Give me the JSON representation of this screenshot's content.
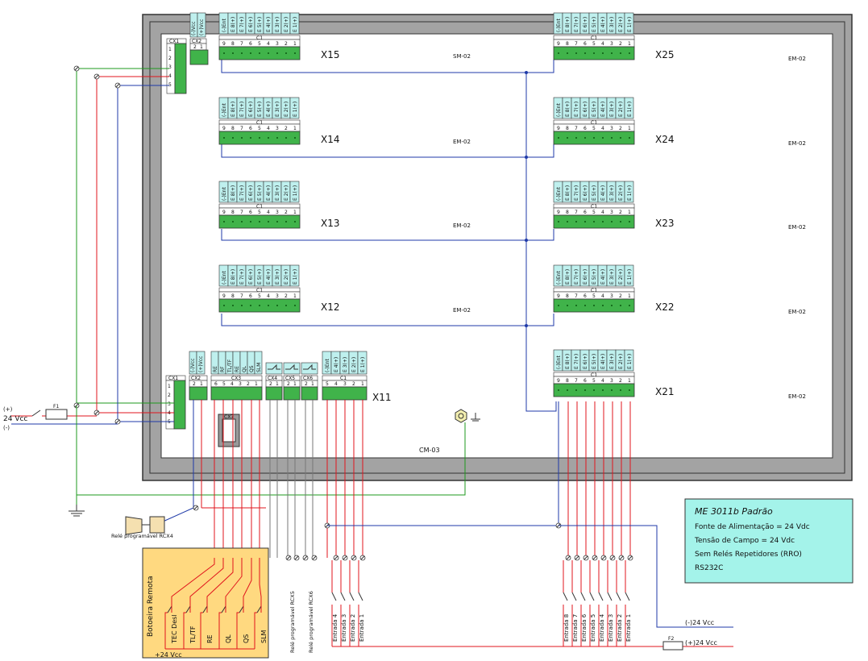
{
  "colors": {
    "frame": "#a3a3a3",
    "panel": "#ffffff",
    "terminal": "#40b34a",
    "label_box": "#bff0ee",
    "note_box": "#a4f3ea",
    "remote_box": "#ffd980",
    "red": "#e0141c",
    "blue": "#1f3aa8",
    "green": "#1c9a1c",
    "gray": "#555555"
  },
  "panel": {
    "title": "CM-03"
  },
  "modules": [
    {
      "id": "X15",
      "tag": "SM-02"
    },
    {
      "id": "X14",
      "tag": "EM-02"
    },
    {
      "id": "X13",
      "tag": "EM-02"
    },
    {
      "id": "X12",
      "tag": "EM-02"
    },
    {
      "id": "X25",
      "tag": "EM-02"
    },
    {
      "id": "X24",
      "tag": "EM-02"
    },
    {
      "id": "X23",
      "tag": "EM-02"
    },
    {
      "id": "X22",
      "tag": "EM-02"
    },
    {
      "id": "X21",
      "tag": "EM-02"
    }
  ],
  "module_conn": {
    "header": "C1",
    "pins": [
      "9",
      "8",
      "7",
      "6",
      "5",
      "4",
      "3",
      "2",
      "1"
    ],
    "labels": [
      "(-)Ent",
      "E 8(+)",
      "E 7(+)",
      "E 6(+)",
      "E 5(+)",
      "E 4(+)",
      "E 3(+)",
      "E 2(+)",
      "E 1(+)"
    ]
  },
  "x11": {
    "id": "X11",
    "cx1": {
      "header": "CX1",
      "pins": [
        "1",
        "2",
        "3",
        "4",
        "5"
      ]
    },
    "cx2": {
      "header": "CX2",
      "pins": [
        "2",
        "1"
      ],
      "labels": [
        "(-)Vcc",
        "(+)Vcc"
      ]
    },
    "cx3": {
      "header": "CX3",
      "pins": [
        "6",
        "5",
        "4",
        "3",
        "2",
        "1"
      ],
      "labels": [
        "RE",
        "RF",
        "TL/TF",
        "RE",
        "QL",
        "QS",
        "SLM"
      ]
    },
    "cx4": {
      "header": "CX4",
      "pins": [
        "2",
        "1"
      ]
    },
    "cx5": {
      "header": "CX5",
      "pins": [
        "2",
        "1"
      ]
    },
    "cx6": {
      "header": "CX6",
      "pins": [
        "2",
        "1"
      ]
    },
    "c1": {
      "header": "C1",
      "pins": [
        "5",
        "4",
        "3",
        "2",
        "1"
      ],
      "labels": [
        "(-)Ent",
        "E 4(+)",
        "E 3(+)",
        "E 2(+)",
        "E 1(+)"
      ]
    },
    "cx7": "CX7"
  },
  "top_power": {
    "cx1": "CX1",
    "cx2": "CX2",
    "cx2_pins": [
      "2",
      "1"
    ],
    "cx1_pins": [
      "1",
      "2",
      "3",
      "4",
      "5"
    ],
    "labels": [
      "(-)Vcc",
      "(+)Vcc"
    ]
  },
  "supply": {
    "plus": "(+)",
    "volt": "24  Vcc",
    "minus": "(-)",
    "fuse": "F1"
  },
  "relay4": "Relé programável RCX4",
  "remote": {
    "title": "Botoeira Remota",
    "buttons": [
      "TEC Desl",
      "TL/TF",
      "RE",
      "QL",
      "QS",
      "SLM"
    ],
    "supply": "+24  Vcc"
  },
  "relays": [
    "Relé programável RCX5",
    "Relé programável RCX6"
  ],
  "inputs_x11": [
    "Entrada 4",
    "Entrada 3",
    "Entrada 2",
    "Entrada 1"
  ],
  "inputs_x21": [
    "Entrada 8",
    "Entrada 7",
    "Entrada 6",
    "Entrada 5",
    "Entrada 4",
    "Entrada 3",
    "Entrada 2",
    "Entrada 1"
  ],
  "field_supply": {
    "minus": "(-)24  Vcc",
    "plus": "(+)24  Vcc",
    "fuse": "F2"
  },
  "note": {
    "title": "ME 3011b Padrão",
    "lines": [
      "Fonte de Alimentação = 24 Vdc",
      "Tensão de Campo = 24 Vdc",
      "Sem Relés Repetidores (RRO)",
      "RS232C"
    ]
  }
}
